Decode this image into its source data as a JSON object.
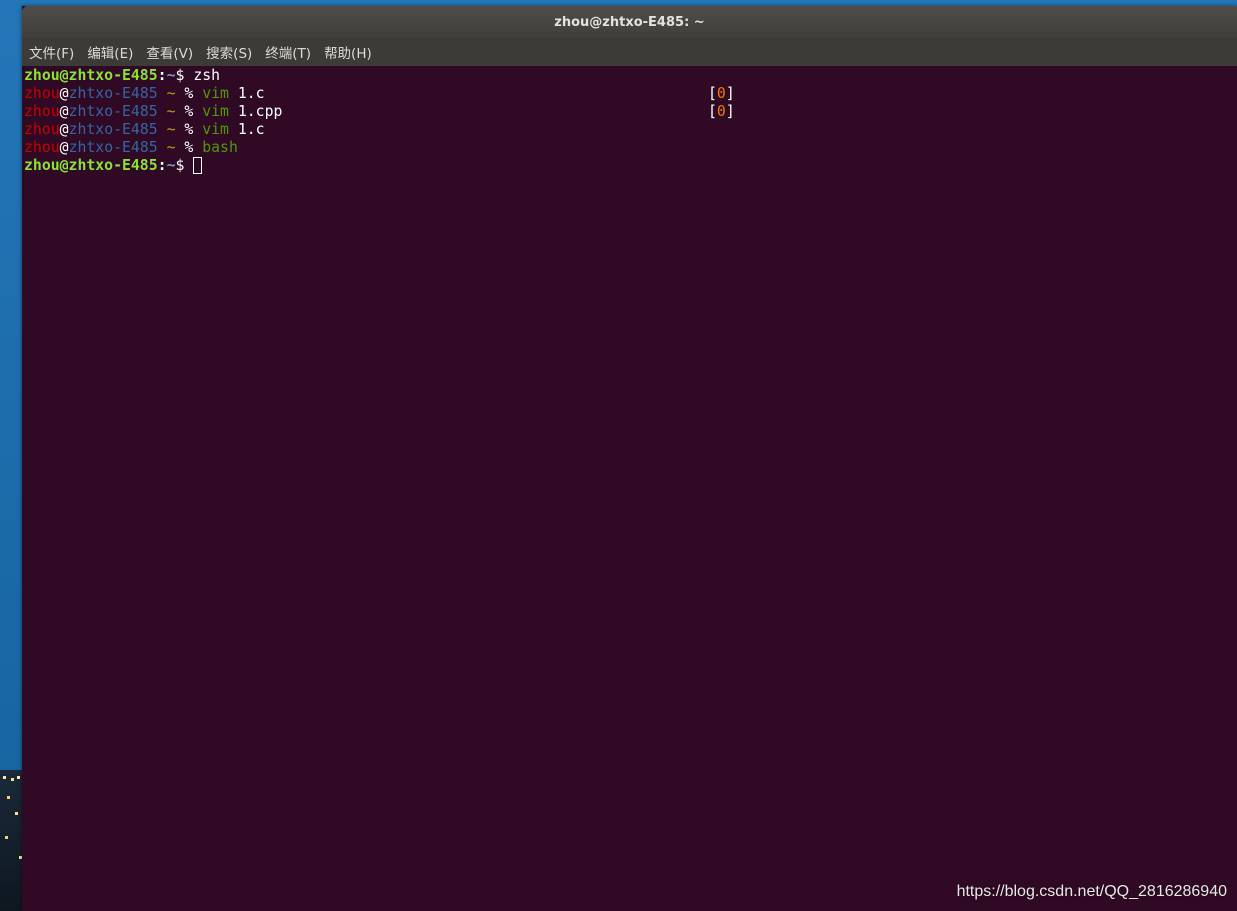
{
  "window": {
    "title": "zhou@zhtxo-E485: ~"
  },
  "menu": [
    "文件(F)",
    "编辑(E)",
    "查看(V)",
    "搜索(S)",
    "终端(T)",
    "帮助(H)"
  ],
  "terminal": {
    "lines": [
      {
        "type": "bash",
        "user_host": "zhou@zhtxo-E485",
        "sep": ":",
        "path": "~",
        "sym": "$ ",
        "cmd": "zsh"
      },
      {
        "type": "zsh",
        "user": "zhou",
        "at": "@",
        "host": "zhtxo-E485",
        "tilde": " ~ ",
        "pct": "% ",
        "cmd": "vim",
        "arg": " 1.c",
        "rprompt": {
          "open": "[",
          "code": "0",
          "close": "]"
        }
      },
      {
        "type": "zsh",
        "user": "zhou",
        "at": "@",
        "host": "zhtxo-E485",
        "tilde": " ~ ",
        "pct": "% ",
        "cmd": "vim",
        "arg": " 1.cpp",
        "rprompt": {
          "open": "[",
          "code": "0",
          "close": "]"
        }
      },
      {
        "type": "zsh",
        "user": "zhou",
        "at": "@",
        "host": "zhtxo-E485",
        "tilde": " ~ ",
        "pct": "% ",
        "cmd": "vim",
        "arg": " 1.c"
      },
      {
        "type": "zsh",
        "user": "zhou",
        "at": "@",
        "host": "zhtxo-E485",
        "tilde": " ~ ",
        "pct": "% ",
        "cmd": "bash",
        "arg": ""
      },
      {
        "type": "bash",
        "user_host": "zhou@zhtxo-E485",
        "sep": ":",
        "path": "~",
        "sym": "$ ",
        "cmd": ""
      }
    ]
  },
  "watermark": "https://blog.csdn.net/QQ_2816286940",
  "colors": {
    "terminal_bg": "#300a24",
    "bash_prompt_green": "#8ae234",
    "zsh_user_red": "#cc0000",
    "zsh_host_blue": "#3465a4",
    "zsh_tilde_yellow": "#c4a000",
    "zsh_cmd_green": "#4e9a06",
    "exit_code_orange": "#f57900"
  }
}
